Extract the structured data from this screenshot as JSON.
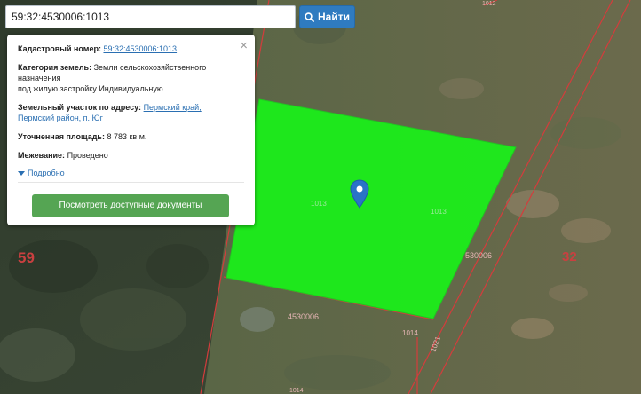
{
  "search": {
    "value": "59:32:4530006:1013",
    "button_label": "Найти"
  },
  "popup": {
    "close_symbol": "×",
    "cadastral_label": "Кадастровый номер:",
    "cadastral_value": "59:32:4530006:1013",
    "category_label": "Категория земель:",
    "category_value_1": "Земли сельскохозяйственного",
    "category_value_2": "назначения",
    "category_value_3": "под жилую застройку Индивидуальную",
    "address_label": "Земельный участок по адресу:",
    "address_value_1": "Пермский край,",
    "address_value_2": "Пермский район, п. Юг",
    "area_label": "Уточненная площадь:",
    "area_value": "8 783 кв.м.",
    "survey_label": "Межевание:",
    "survey_value": "Проведено",
    "more_label": "Подробно",
    "docs_button_label": "Посмотреть доступные документы"
  },
  "map": {
    "parcel_color": "#19f219",
    "boundary_color": "#d43c3c",
    "label_color": "#e8b7b7",
    "marker_color": "#2a73c8",
    "labels": {
      "region_59": "59",
      "region_32": "32",
      "parcel_1013_left": "1013",
      "parcel_1013_right": "1013",
      "quarter_530006": "530006",
      "quarter_4530006": "4530006",
      "parcel_1014": "1014",
      "parcel_1021": "1021",
      "parcel_1012": "1012",
      "parcel_1014_bottom": "1014"
    }
  }
}
